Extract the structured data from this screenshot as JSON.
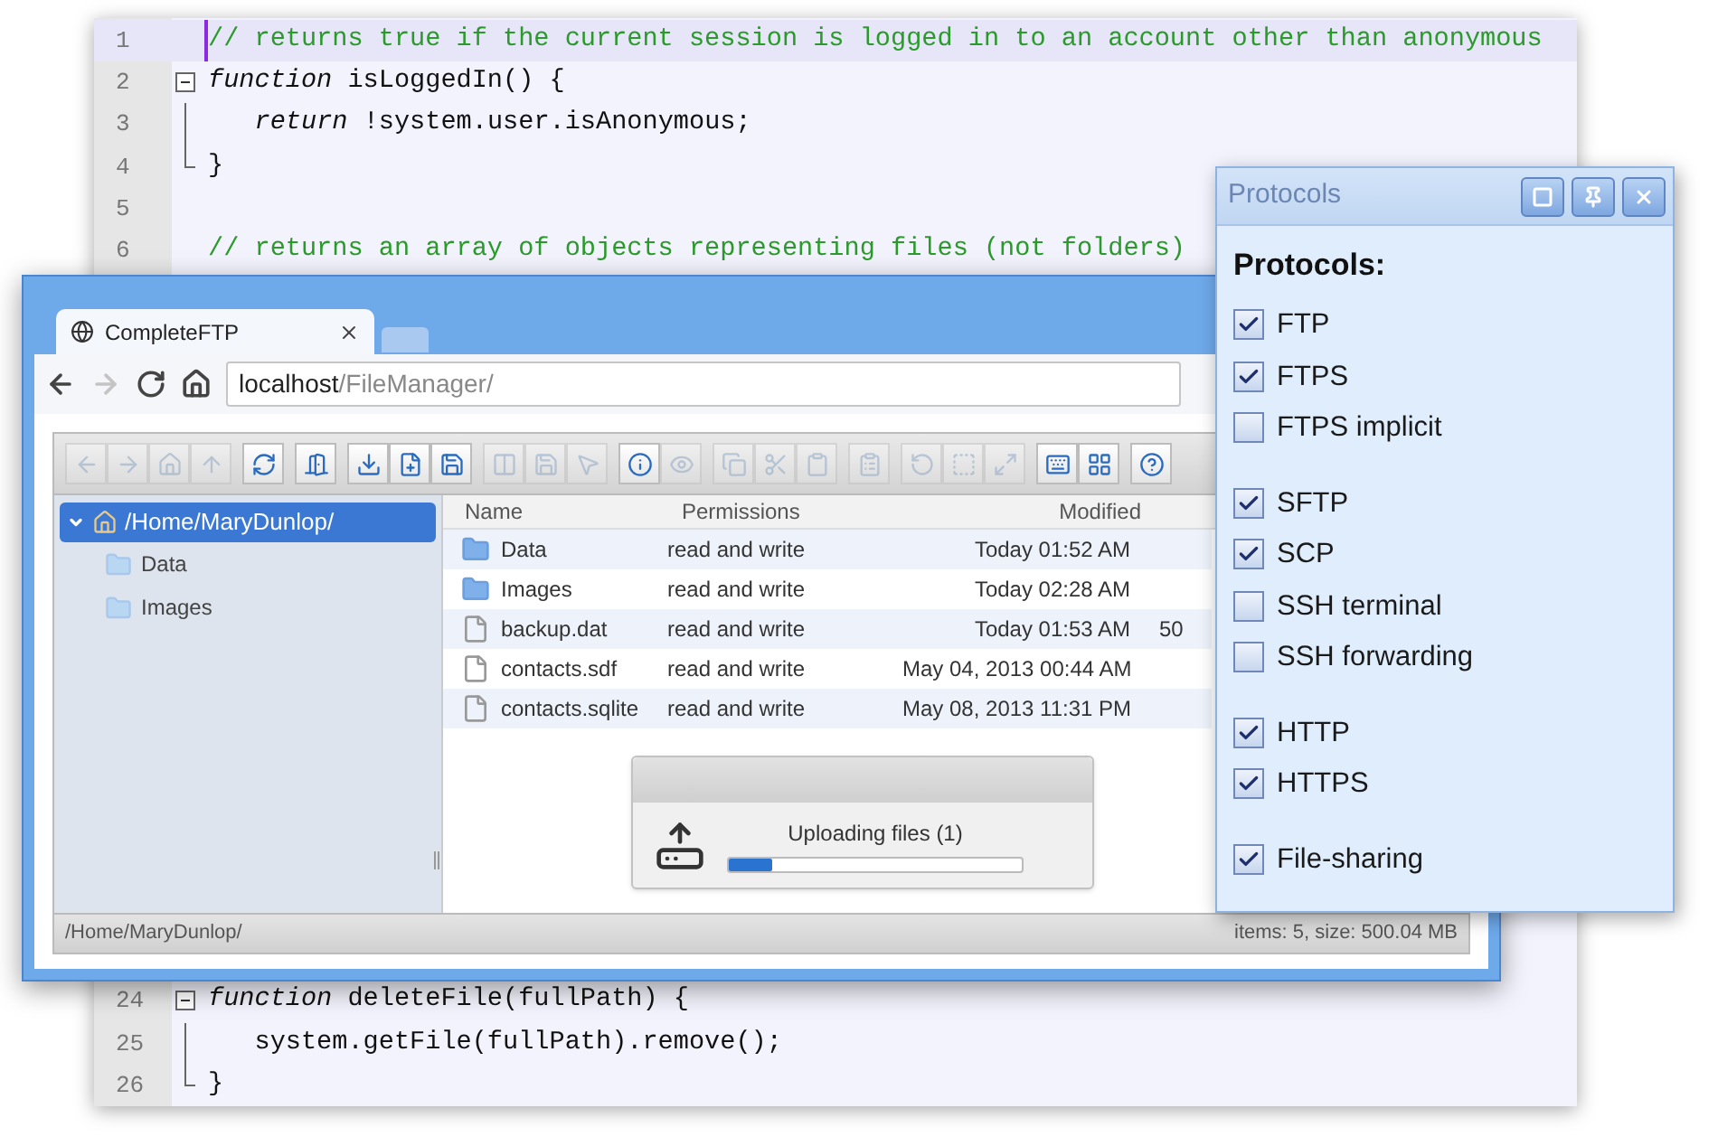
{
  "editor": {
    "top_lines": [
      {
        "number": "1",
        "text": "// returns true if the current session is logged in to an account other than anonymous",
        "kind": "comment",
        "current": true
      },
      {
        "number": "2",
        "text": "*function* isLoggedIn() {",
        "kind": "code",
        "current": false,
        "expanded": true,
        "children": [
          {
            "number": "3",
            "text": "   *return* !system.user.isAnonymous;",
            "kind": "code",
            "current": false
          },
          {
            "number": "4",
            "text": "}",
            "kind": "code",
            "current": false
          }
        ]
      },
      {
        "number": "5",
        "current": false
      },
      {
        "number": "6",
        "text": "// returns an array of objects representing files (not folders)",
        "kind": "comment",
        "current": false
      }
    ],
    "bottom_lines": [
      {
        "number": "24",
        "text": "*function* deleteFile(fullPath) {",
        "kind": "code",
        "current": false,
        "expanded": true,
        "children": [
          {
            "number": "25",
            "text": "   system.getFile(fullPath).remove();",
            "kind": "code",
            "current": false
          },
          {
            "number": "26",
            "text": "}",
            "kind": "code",
            "current": false
          }
        ]
      }
    ]
  },
  "browser": {
    "tab": {
      "title": "CompleteFTP"
    },
    "nav_buttons": [
      {
        "disabled": false
      },
      {
        "disabled": true
      },
      {
        "disabled": false
      },
      {
        "disabled": false
      }
    ],
    "address": {
      "host": "localhost",
      "path": "/FileManager/"
    },
    "toolbar": [
      [
        {
          "disabled": true
        },
        {
          "disabled": true
        },
        {
          "disabled": true
        },
        {
          "disabled": true
        }
      ],
      [
        {
          "disabled": false
        }
      ],
      [
        {
          "disabled": false
        }
      ],
      [
        {
          "disabled": false
        },
        {
          "disabled": false
        },
        {
          "disabled": false
        }
      ],
      [
        {
          "disabled": true
        },
        {
          "disabled": true
        },
        {
          "disabled": true
        }
      ],
      [
        {
          "disabled": false
        },
        {
          "disabled": true
        }
      ],
      [
        {
          "disabled": true
        },
        {
          "disabled": true
        },
        {
          "disabled": true
        }
      ],
      [
        {
          "disabled": true
        }
      ],
      [
        {
          "disabled": true
        },
        {
          "disabled": true
        },
        {
          "disabled": true
        }
      ],
      [
        {
          "disabled": false
        },
        {
          "disabled": false
        }
      ],
      [
        {
          "disabled": false
        }
      ]
    ],
    "tree": {
      "label": "/Home/MaryDunlop/",
      "selected": true,
      "expanded": true,
      "children": [
        {
          "label": "Data",
          "selected": false
        },
        {
          "label": "Images",
          "selected": false
        }
      ]
    },
    "table": {
      "columns": [
        "Name",
        "Permissions",
        "Modified"
      ],
      "rows": [
        {
          "kind": "folder",
          "name": "Data",
          "permissions": "read and write",
          "modified": "Today 01:52 AM"
        },
        {
          "kind": "folder",
          "name": "Images",
          "permissions": "read and write",
          "modified": "Today 02:28 AM"
        },
        {
          "kind": "file",
          "name": "backup.dat",
          "permissions": "read and write",
          "modified": "Today 01:53 AM",
          "size": "50"
        },
        {
          "kind": "file",
          "name": "contacts.sdf",
          "permissions": "read and write",
          "modified": "May 04, 2013 00:44 AM"
        },
        {
          "kind": "file",
          "name": "contacts.sqlite",
          "permissions": "read and write",
          "modified": "May 08, 2013 11:31 PM"
        }
      ]
    },
    "upload_dialog": {
      "message": "Uploading files (1)",
      "level": 0.15
    },
    "status_bar": {
      "path": "/Home/MaryDunlop/",
      "summary": "items: 5, size: 500.04 MB"
    }
  },
  "protocols_panel": {
    "title": "Protocols",
    "heading": "Protocols:",
    "groups": [
      [
        {
          "label": "FTP",
          "checked": true
        },
        {
          "label": "FTPS",
          "checked": true
        },
        {
          "label": "FTPS implicit",
          "checked": false
        }
      ],
      [
        {
          "label": "SFTP",
          "checked": true
        },
        {
          "label": "SCP",
          "checked": true
        },
        {
          "label": "SSH terminal",
          "checked": false
        },
        {
          "label": "SSH forwarding",
          "checked": false
        }
      ],
      [
        {
          "label": "HTTP",
          "checked": true
        },
        {
          "label": "HTTPS",
          "checked": true
        }
      ],
      [
        {
          "label": "File-sharing",
          "checked": true
        }
      ]
    ]
  }
}
